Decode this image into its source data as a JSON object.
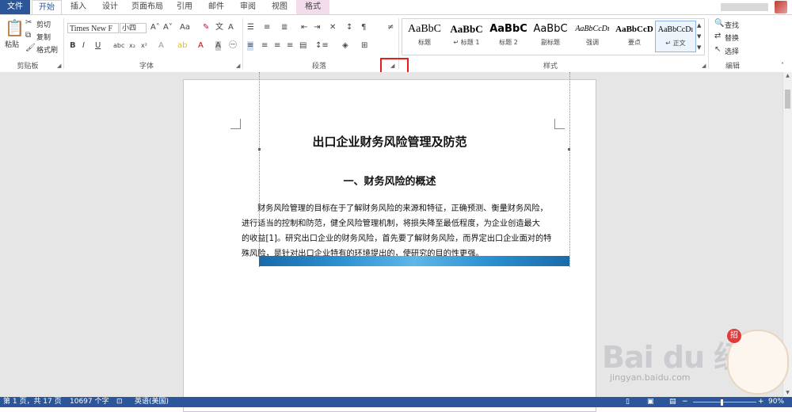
{
  "tabs": [
    {
      "label": "文件"
    },
    {
      "label": "开始"
    },
    {
      "label": "插入"
    },
    {
      "label": "设计"
    },
    {
      "label": "页面布局"
    },
    {
      "label": "引用"
    },
    {
      "label": "邮件"
    },
    {
      "label": "审阅"
    },
    {
      "label": "视图"
    },
    {
      "label": "格式"
    }
  ],
  "clipboard": {
    "paste": "粘贴",
    "cut": "剪切",
    "copy": "复制",
    "format_painter": "格式刷",
    "group": "剪贴板"
  },
  "font": {
    "name": "Times New F",
    "size": "小四",
    "group": "字体"
  },
  "paragraph": {
    "group": "段落"
  },
  "styles": {
    "group": "样式",
    "items": [
      {
        "sample": "AaBbC",
        "name": "标题"
      },
      {
        "sample": "AaBbC",
        "name": "↵ 标题 1"
      },
      {
        "sample": "AaBbC",
        "name": "标题 2"
      },
      {
        "sample": "AaBbC",
        "name": "副标题"
      },
      {
        "sample": "AaBbCcDı",
        "name": "强调"
      },
      {
        "sample": "AaBbCcD",
        "name": "要点"
      },
      {
        "sample": "AaBbCcDı",
        "name": "↵ 正文"
      }
    ]
  },
  "editing": {
    "find": "查找",
    "replace": "替换",
    "select": "选择",
    "group": "编辑"
  },
  "document": {
    "title": "出口企业财务风险管理及防范",
    "heading": "一、财务风险的概述",
    "lines": [
      "财务风险管理的目标在于了解财务风险的来源和特征，正确预测、衡量财务风险，",
      "进行适当的控制和防范，健全风险管理机制，将损失降至最低程度，为企业创造最大",
      "的收益[1]。研究出口企业的财务风险，首先要了解财务风险，而界定出口企业面对的特",
      "殊风险，是针对出口企业特有的环境提出的，使研究的目的性更强。"
    ]
  },
  "status": {
    "page": "第 1 页，共 17 页",
    "words": "10697 个字",
    "language": "英语(美国)",
    "zoom": "90%"
  },
  "watermark": {
    "brand": "Bai du 经验",
    "url": "jingyan.baidu.com",
    "badge": "招"
  },
  "colors": {
    "accent": "#2b579a",
    "highlight": "#e02020"
  }
}
